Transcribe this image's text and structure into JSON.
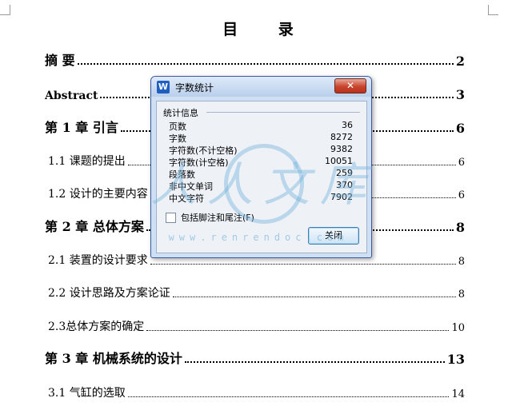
{
  "document": {
    "toc_title": "目 录",
    "entries": [
      {
        "label": "摘    要",
        "page": "2",
        "level": 1
      },
      {
        "label": "Abstract",
        "page": "3",
        "level": 1
      },
      {
        "label": "第 1 章  引言",
        "page": "6",
        "level": 1
      },
      {
        "label": "1.1 课题的提出",
        "page": "6",
        "level": 2
      },
      {
        "label": "1.2 设计的主要内容",
        "page": "6",
        "level": 2
      },
      {
        "label": "第 2 章  总体方案",
        "page": "8",
        "level": 1
      },
      {
        "label": "2.1 装置的设计要求",
        "page": "8",
        "level": 2
      },
      {
        "label": "2.2 设计思路及方案论证",
        "page": "8",
        "level": 2
      },
      {
        "label": "2.3总体方案的确定",
        "page": "10",
        "level": 2
      },
      {
        "label": "第 3 章  机械系统的设计",
        "page": "13",
        "level": 1
      },
      {
        "label": "3.1  气缸的选取",
        "page": "14",
        "level": 2
      }
    ]
  },
  "watermark": {
    "chars": [
      "人",
      "人",
      "文",
      "库"
    ],
    "url": "www.renrendoc.com"
  },
  "dialog": {
    "title": "字数统计",
    "app_icon": "W",
    "close_label": "✕",
    "group_label": "统计信息",
    "stats": [
      {
        "key": "页数",
        "value": "36"
      },
      {
        "key": "字数",
        "value": "8272"
      },
      {
        "key": "字符数(不计空格)",
        "value": "9382"
      },
      {
        "key": "字符数(计空格)",
        "value": "10051"
      },
      {
        "key": "段落数",
        "value": "259"
      },
      {
        "key": "非中文单词",
        "value": "370"
      },
      {
        "key": "中文字符",
        "value": "7902"
      }
    ],
    "checkbox_label": "包括脚注和尾注(F)",
    "checkbox_checked": false,
    "close_button_label": "关闭"
  }
}
